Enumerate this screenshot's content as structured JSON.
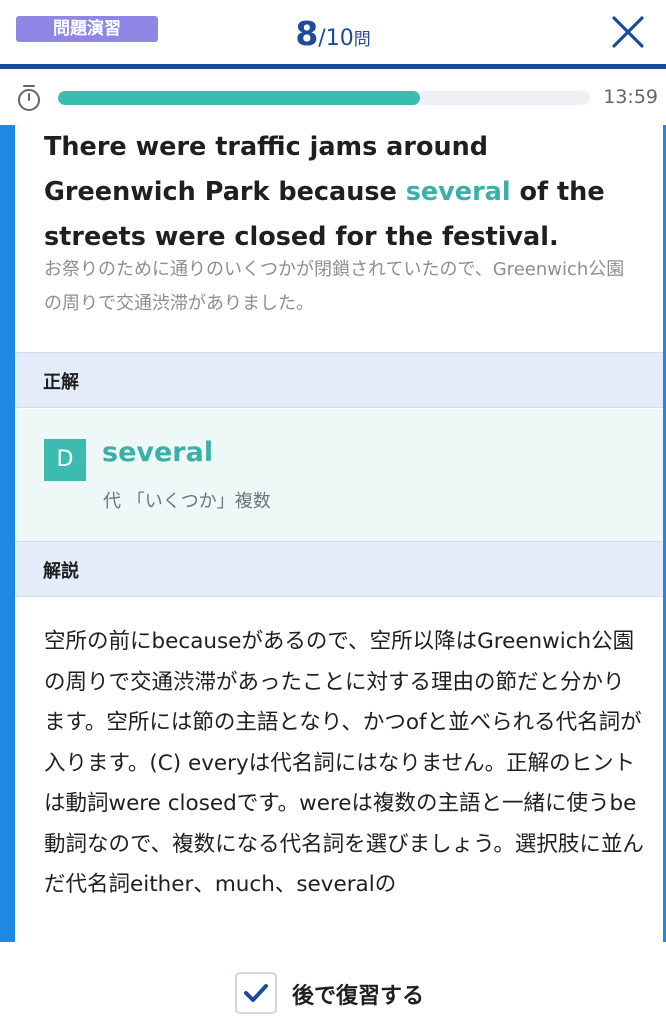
{
  "header": {
    "badge_label": "問題演習",
    "current_question": "8",
    "total_questions": "/10",
    "counter_unit": "問",
    "close_icon": "close-icon"
  },
  "timer": {
    "progress_fraction": 0.68,
    "remaining_time": "13:59",
    "icon": "stopwatch-icon"
  },
  "question": {
    "sentence_before": "There were traffic jams around Greenwich Park because ",
    "sentence_highlight": "several",
    "sentence_after": " of the streets were closed for the festival.",
    "translation": "お祭りのために通りのいくつかが閉鎖されていたので、Greenwich公園の周りで交通渋滞がありました。"
  },
  "answer_section": {
    "heading": "正解",
    "choice_letter": "D",
    "word": "several",
    "meaning": "代 「いくつか」複数"
  },
  "explanation_section": {
    "heading": "解説",
    "text": "空所の前にbecauseがあるので、空所以降はGreenwich公園の周りで交通渋滞があったことに対する理由の節だと分かります。空所には節の主語となり、かつofと並べられる代名詞が入ります。(C) everyは代名詞にはなりません。正解のヒントは動詞were closedです。wereは複数の主語と一緒に使うbe動詞なので、複数になる代名詞を選びましょう。選択肢に並んだ代名詞either、much、severalの"
  },
  "footer": {
    "review_label": "後で復習する",
    "review_checked": true,
    "check_icon": "checkmark-icon"
  },
  "colors": {
    "brand_blue": "#1e4a9b",
    "accent_teal": "#3cbcb0",
    "badge_purple": "#8f86e6",
    "side_bar_blue": "#1e88e5"
  }
}
